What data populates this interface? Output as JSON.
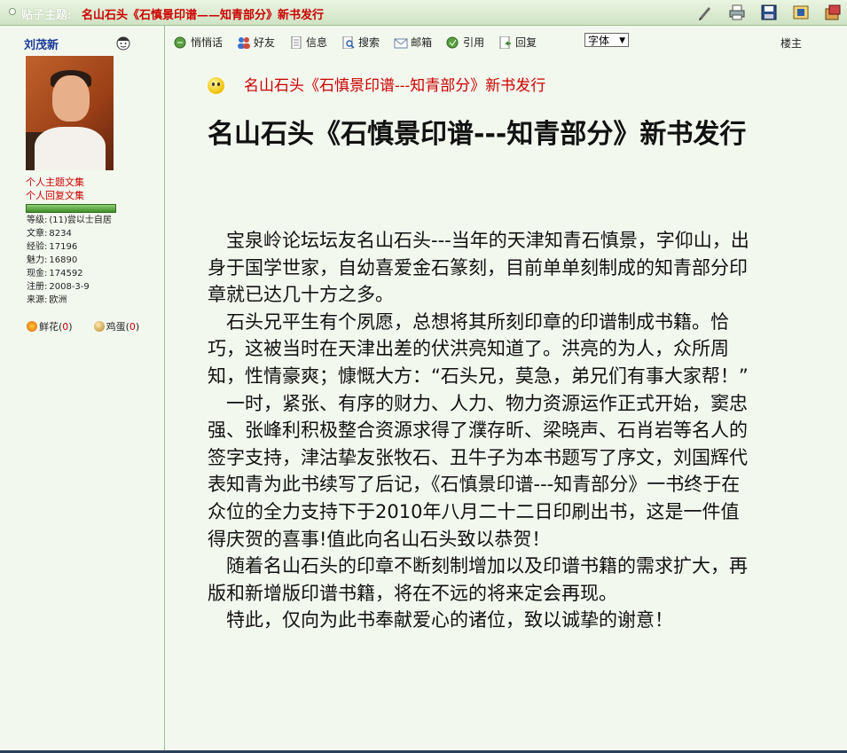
{
  "header": {
    "label": "贴子主题:",
    "title": "名山石头《石慎景印谱——知青部分》新书发行",
    "icons": [
      "pen-icon",
      "print-icon",
      "save-icon",
      "bookmark-icon",
      "collection-icon"
    ]
  },
  "user": {
    "name": "刘茂新",
    "links": [
      "个人主题文集",
      "个人回复文集"
    ],
    "stats": [
      {
        "label": "等级:",
        "value": "(11)尝以士自居"
      },
      {
        "label": "文章:",
        "value": "8234"
      },
      {
        "label": "经验:",
        "value": "17196"
      },
      {
        "label": "魅力:",
        "value": "16890"
      },
      {
        "label": "现金:",
        "value": "174592"
      },
      {
        "label": "注册:",
        "value": "2008-3-9"
      },
      {
        "label": "来源:",
        "value": "欧洲"
      }
    ],
    "flower_label": "鲜花",
    "flower_count": "0",
    "egg_label": "鸡蛋",
    "egg_count": "0"
  },
  "toolbar": {
    "items": [
      "悄悄话",
      "好友",
      "信息",
      "搜索",
      "邮箱",
      "引用",
      "回复"
    ],
    "font_select": "字体",
    "floor": "楼主"
  },
  "post": {
    "title": "名山石头《石慎景印谱---知青部分》新书发行",
    "heading": "名山石头《石慎景印谱---知青部分》新书发行",
    "paragraphs": [
      "宝泉岭论坛坛友名山石头---当年的天津知青石慎景，字仰山，出身于国学世家，自幼喜爱金石篆刻，目前单单刻制成的知青部分印章就已达几十方之多。",
      "石头兄平生有个夙愿，总想将其所刻印章的印谱制成书籍。恰巧，这被当时在天津出差的伏洪亮知道了。洪亮的为人，众所周知，性情豪爽；慷慨大方：“石头兄，莫急，弟兄们有事大家帮！”",
      "一时，紧张、有序的财力、人力、物力资源运作正式开始，窦忠强、张峰利积极整合资源求得了濮存昕、梁晓声、石肖岩等名人的签字支持，津沽挚友张牧石、丑牛子为本书题写了序文，刘国辉代表知青为此书续写了后记，《石慎景印谱---知青部分》一书终于在众位的全力支持下于2010年八月二十二日印刷出书，这是一件值得庆贺的喜事!值此向名山石头致以恭贺！",
      "随着名山石头的印章不断刻制增加以及印谱书籍的需求扩大，再版和新增版印谱书籍，将在不远的将来定会再现。",
      "特此，仅向为此书奉献爱心的诸位，致以诚挚的谢意！"
    ]
  }
}
